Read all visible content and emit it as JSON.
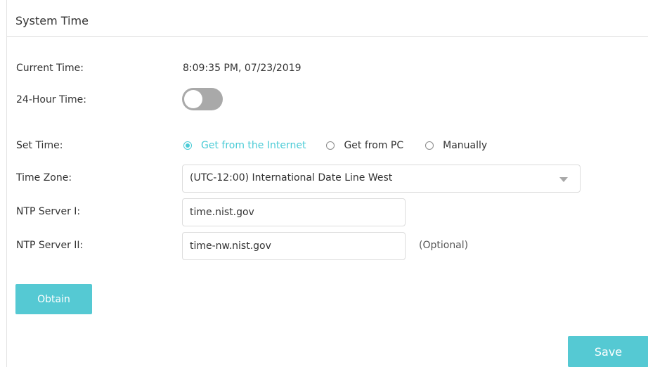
{
  "section": {
    "title": "System Time"
  },
  "current_time": {
    "label": "Current Time:",
    "value": "8:09:35 PM, 07/23/2019"
  },
  "hour24": {
    "label": "24-Hour Time:",
    "enabled": false
  },
  "set_time": {
    "label": "Set Time:",
    "options": [
      {
        "label": "Get from the Internet",
        "selected": true
      },
      {
        "label": "Get from PC",
        "selected": false
      },
      {
        "label": "Manually",
        "selected": false
      }
    ]
  },
  "time_zone": {
    "label": "Time Zone:",
    "selected": "(UTC-12:00) International Date Line West"
  },
  "ntp1": {
    "label": "NTP Server I:",
    "value": "time.nist.gov"
  },
  "ntp2": {
    "label": "NTP Server II:",
    "value": "time-nw.nist.gov",
    "note": "(Optional)"
  },
  "buttons": {
    "obtain": "Obtain",
    "save": "Save"
  },
  "colors": {
    "accent": "#4acbd6",
    "button": "#55c9d3",
    "toggle_off": "#a9a9a9"
  },
  "icons": {
    "dropdown": "chevron-down-icon"
  }
}
